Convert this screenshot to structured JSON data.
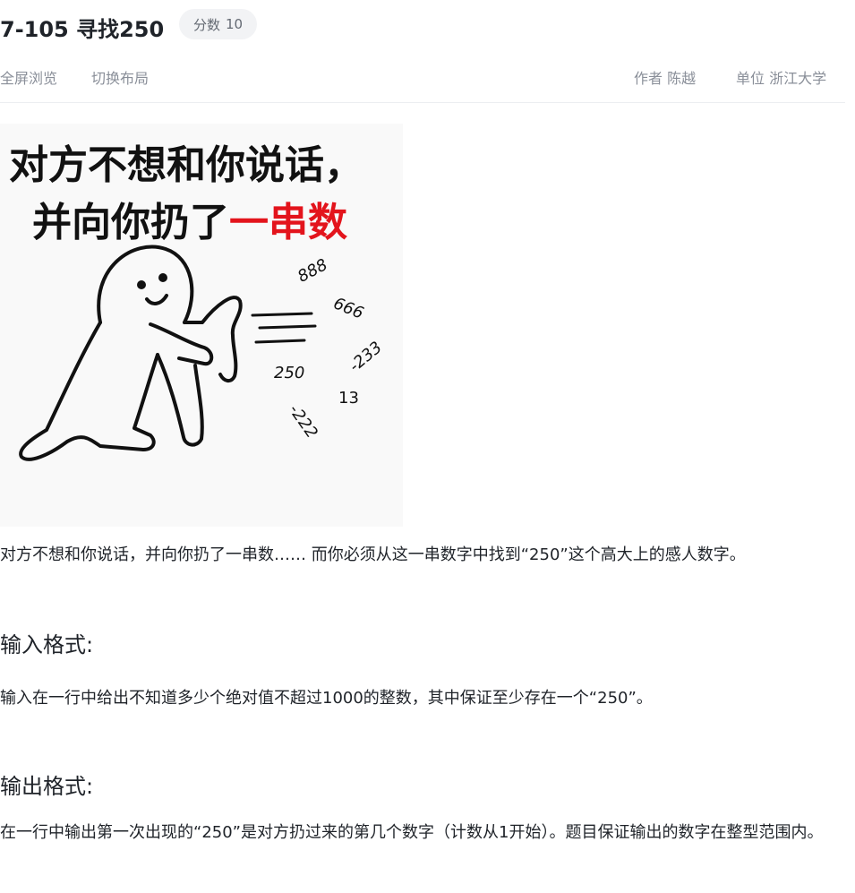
{
  "header": {
    "title": "7-105 寻找250",
    "score_label": "分数",
    "score_value": "10"
  },
  "toolbar": {
    "fullscreen": "全屏浏览",
    "switch_layout": "切换布局",
    "author_label": "作者",
    "author": "陈越",
    "unit_label": "单位",
    "unit": "浙江大学"
  },
  "meme": {
    "line1": "对方不想和你说话，",
    "line2_black": "并向你扔了",
    "line2_red": "一串数",
    "numbers": [
      "888",
      "666",
      "-233",
      "250",
      "13",
      "-222"
    ]
  },
  "intro": "对方不想和你说话，并向你扔了一串数…… 而你必须从这一串数字中找到“250”这个高大上的感人数字。",
  "input_section": {
    "heading": "输入格式:",
    "body": "输入在一行中给出不知道多少个绝对值不超过1000的整数，其中保证至少存在一个“250”。"
  },
  "output_section": {
    "heading": "输出格式:",
    "body": "在一行中输出第一次出现的“250”是对方扔过来的第几个数字（计数从1开始）。题目保证输出的数字在整型范围内。"
  }
}
